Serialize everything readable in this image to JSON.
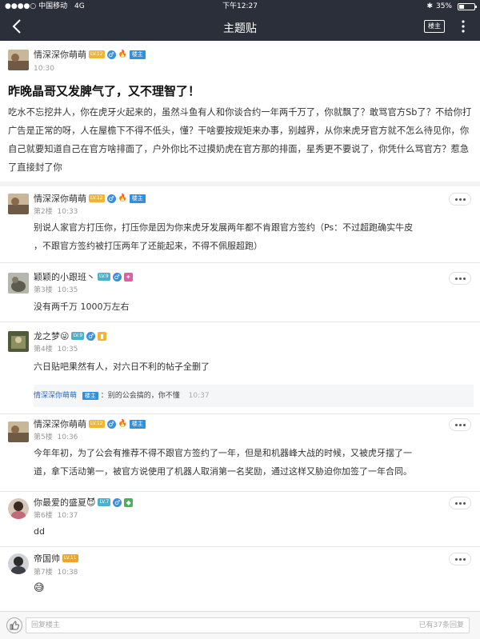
{
  "status": {
    "carrier": "中国移动",
    "network": "4G",
    "time": "下午12:27",
    "battery": "35%",
    "battery_level": 0.35
  },
  "nav": {
    "title": "主题贴",
    "button_label": "楼主"
  },
  "post": {
    "author": "情深深你萌萌",
    "level": "LV.12",
    "owner_badge": "楼主",
    "time": "10:30",
    "title": "昨晚晶哥又发脾气了，又不理智了！",
    "body": "吃水不忘挖井人，你在虎牙火起来的，虽然斗鱼有人和你谈合约一年两千万了，你就飘了？敢骂官方Sb了？不给你打广告是正常的呀，人在屋檐下不得不低头，懂？干啥要按规矩来办事，别越界，从你来虎牙官方就不怎么待见你，你自己就要知道自己在官方啥排面了，户外你比不过摸奶虎在官方那的排面，星秀更不要说了，你凭什么骂官方？惹急了直接封了你"
  },
  "replies": [
    {
      "author": "情深深你萌萌",
      "level": "LV.12",
      "owner_badge": "楼主",
      "floor": "第2楼",
      "time": "10:33",
      "text": [
        "别说人家官方打压你，打压你是因为你来虎牙发展两年都不肯跟官方签约（Ps：不过超跑确实牛皮",
        "，不跟官方签约被打压两年了还能起来，不得不佩服超跑）"
      ]
    },
    {
      "author": "颖颖的小跟班丶",
      "level": "LV.9",
      "floor": "第3楼",
      "time": "10:35",
      "text": [
        "没有两千万 1000万左右"
      ]
    },
    {
      "author": "龙之梦😜",
      "level": "LV.9",
      "floor": "第4楼",
      "time": "10:35",
      "text": [
        "六日贴吧果然有人，对六日不利的帖子全删了"
      ],
      "sub": {
        "author": "情深深你萌萌",
        "owner_badge": "楼主",
        "text": "：别的公会搞的，你不懂",
        "time": "10:37"
      }
    },
    {
      "author": "情深深你萌萌",
      "level": "LV.12",
      "owner_badge": "楼主",
      "floor": "第5楼",
      "time": "10:36",
      "text": [
        "今年年初，为了公会有推荐不得不跟官方签约了一年，但是和机器峰大战的时候，又被虎牙摆了一",
        "道，拿下活动第一，被官方说使用了机器人取消第一名奖励，通过这样又胁迫你加签了一年合同。"
      ]
    },
    {
      "author": "你最爱的盛夏😈",
      "level": "LV.7",
      "floor": "第6楼",
      "time": "10:37",
      "text": [
        "dd"
      ]
    },
    {
      "author": "帝国帅",
      "level": "LV.11",
      "floor": "第7楼",
      "time": "10:38",
      "text": [
        "😅"
      ]
    }
  ],
  "bottom": {
    "placeholder": "回复楼主",
    "count": "已有37条回复"
  },
  "colors": {
    "header": "#2b2f3a",
    "owner_badge": "#2f8fe0",
    "level_badge": "#f2b431",
    "male": "#3b8fe0"
  }
}
